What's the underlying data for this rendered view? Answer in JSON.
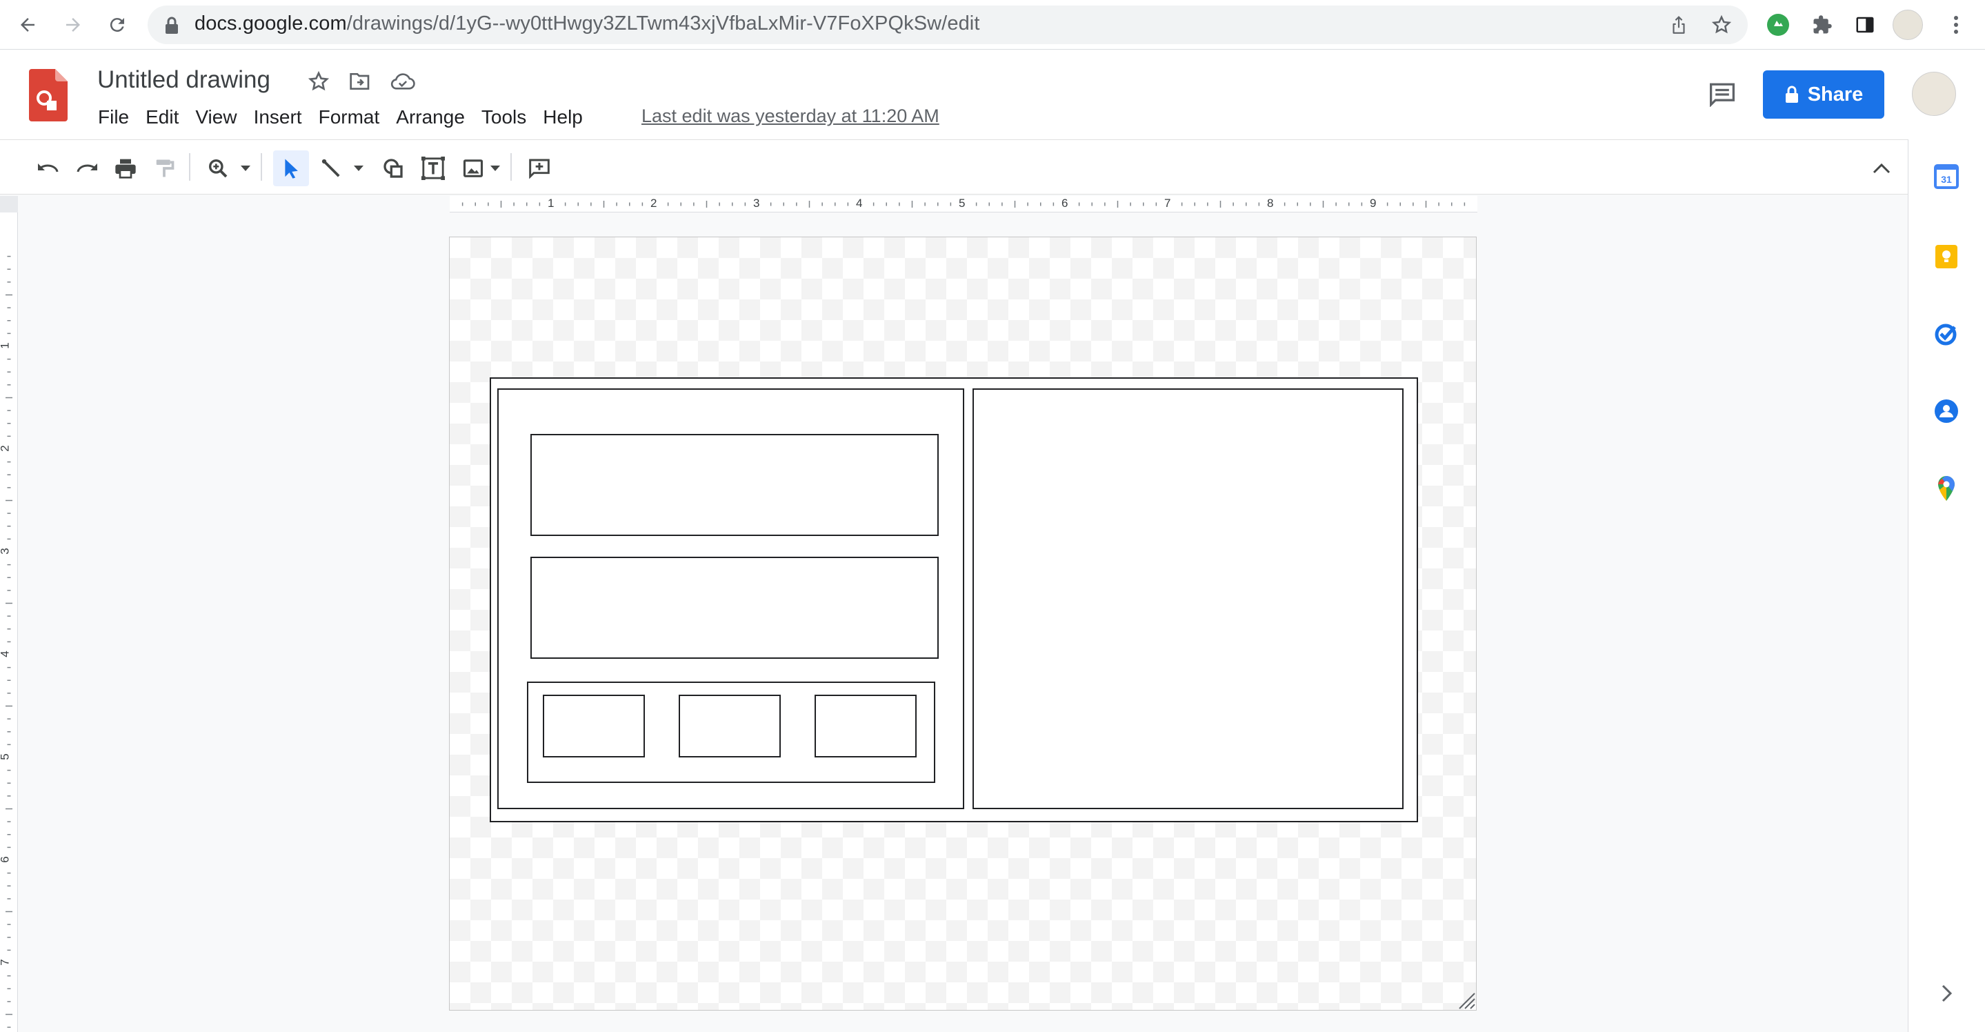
{
  "browser": {
    "url_host": "docs.google.com",
    "url_path": "/drawings/d/1yG--wy0ttHwgy3ZLTwm43xjVfbaLxMir-V7FoXPQkSw/edit"
  },
  "doc": {
    "title": "Untitled drawing",
    "last_edit": "Last edit was yesterday at 11:20 AM",
    "share_label": "Share"
  },
  "menu": [
    "File",
    "Edit",
    "View",
    "Insert",
    "Format",
    "Arrange",
    "Tools",
    "Help"
  ],
  "ruler": {
    "horizontal": [
      "1",
      "2",
      "3",
      "4",
      "5",
      "6",
      "7",
      "8",
      "9"
    ],
    "vertical": [
      "1",
      "2",
      "3",
      "4",
      "5",
      "6",
      "7"
    ]
  },
  "toolbar_icons": [
    "undo-icon",
    "redo-icon",
    "print-icon",
    "paint-format-icon",
    "zoom-icon",
    "select-icon",
    "line-icon",
    "shape-icon",
    "text-box-icon",
    "image-icon",
    "comment-icon"
  ],
  "side_apps": [
    "calendar-icon",
    "keep-icon",
    "tasks-icon",
    "contacts-icon",
    "maps-icon"
  ],
  "calendar_day": "31",
  "colors": {
    "brand_red": "#db4437",
    "share_blue": "#1a73e8",
    "select_blue": "#1a73e8"
  }
}
